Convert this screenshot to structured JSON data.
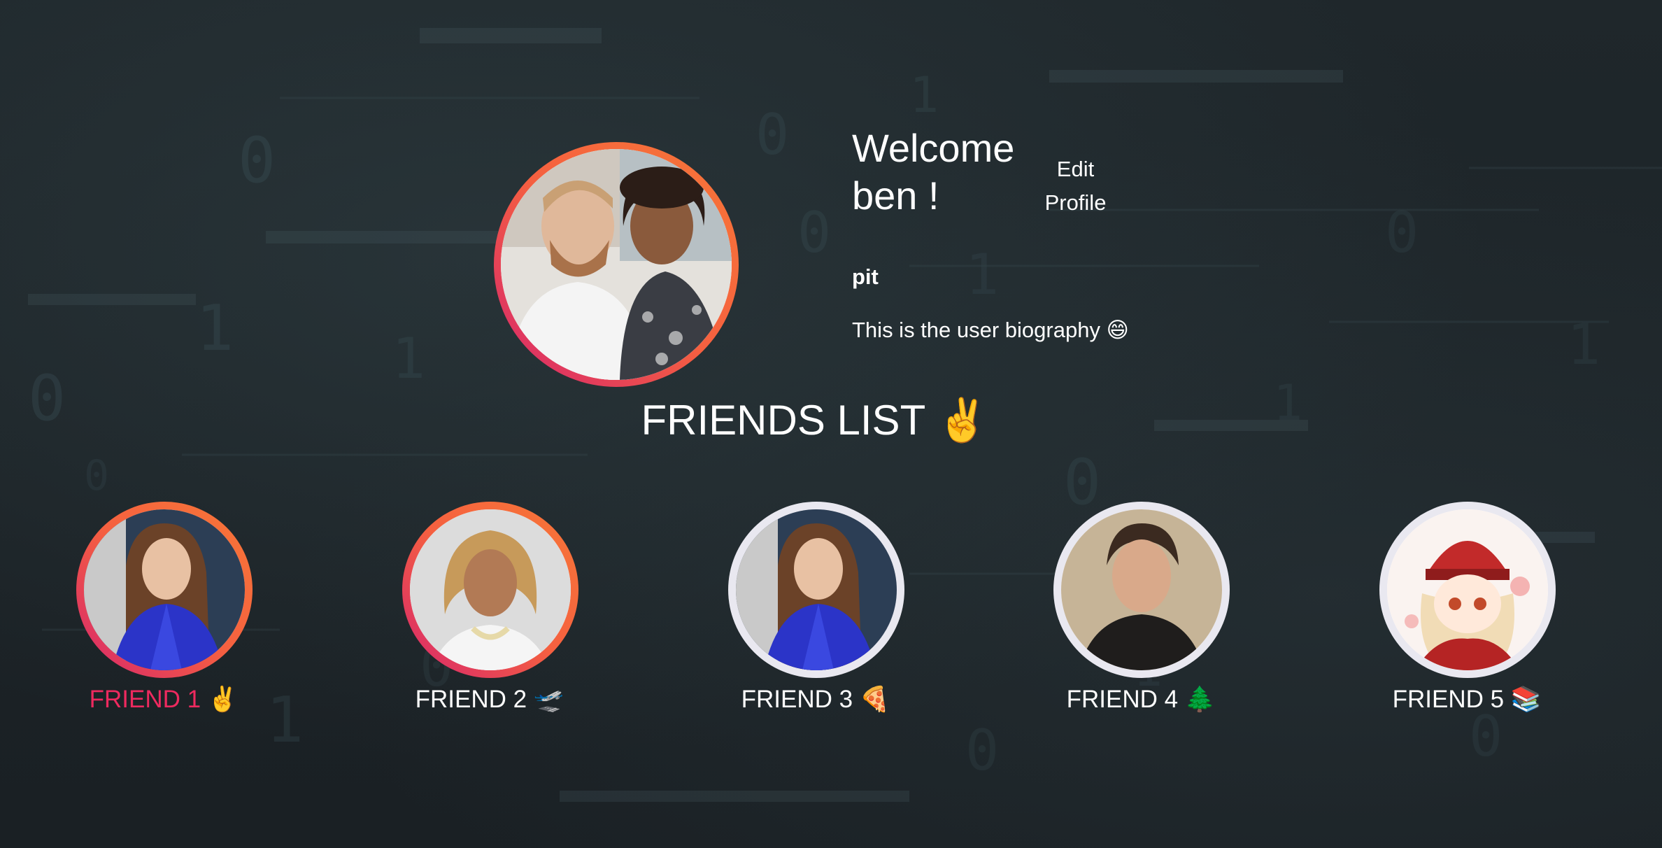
{
  "profile": {
    "welcome": "Welcome ben !",
    "edit_label": "Edit Profile",
    "username": "pit",
    "bio": "This is the user biography 😄",
    "avatar_icon": "profile-photo"
  },
  "friends_section": {
    "title": "FRIENDS LIST ✌️"
  },
  "friends": [
    {
      "label": "FRIEND 1 ✌️",
      "ring": "gradient",
      "active": true
    },
    {
      "label": "FRIEND 2 🛫",
      "ring": "gradient",
      "active": false
    },
    {
      "label": "FRIEND 3 🍕",
      "ring": "white",
      "active": false
    },
    {
      "label": "FRIEND 4 🌲",
      "ring": "white",
      "active": false
    },
    {
      "label": "FRIEND 5 📚",
      "ring": "white",
      "active": false
    }
  ],
  "colors": {
    "ring_gradient_start": "#d6246e",
    "ring_gradient_end": "#f77737",
    "active_label": "#ee2a5f",
    "background": "#1c2226"
  }
}
